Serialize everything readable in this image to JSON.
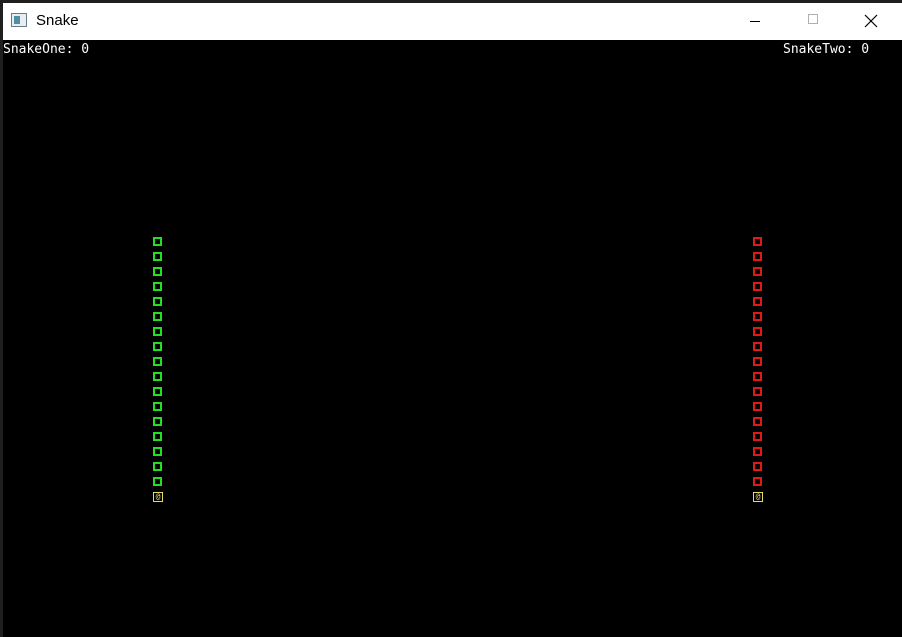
{
  "window": {
    "title": "Snake",
    "icon": "app-window-icon",
    "buttons": [
      "minimize-icon",
      "maximize-icon",
      "close-icon"
    ]
  },
  "scores": {
    "one": "SnakeOne: 0",
    "two": "SnakeTwo: 0"
  },
  "snakes": [
    {
      "name": "snake-one",
      "color": "#22e022",
      "head_color": "#e6d96a",
      "head_glyph": "@",
      "body_segments": 17,
      "direction": "down"
    },
    {
      "name": "snake-two",
      "color": "#e01818",
      "head_color": "#e6d96a",
      "head_glyph": "@",
      "body_segments": 17,
      "direction": "down"
    }
  ],
  "colors": {
    "background": "#000000",
    "score_text": "#ffffff"
  }
}
